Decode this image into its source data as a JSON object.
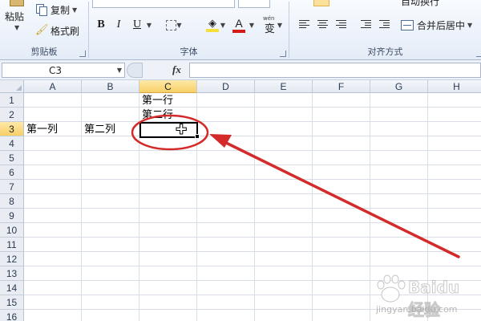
{
  "ribbon": {
    "clipboard": {
      "paste_label": "粘贴",
      "copy_label": "复制",
      "format_painter_label": "格式刷",
      "group_label": "剪贴板"
    },
    "font": {
      "bold_label": "B",
      "italic_label": "I",
      "underline_label": "U",
      "fill_color": "#f5e03b",
      "font_color": "#d61a1a",
      "font_color_glyph": "A",
      "phonetic_glyph": "wén",
      "phonetic_char": "变",
      "group_label": "字体"
    },
    "alignment": {
      "merge_label": "合并后居中",
      "wrap_label": "自动换行",
      "group_label": "对齐方式"
    }
  },
  "formula_bar": {
    "name_box": "C3",
    "fx": "fx",
    "value": ""
  },
  "grid": {
    "columns": [
      "A",
      "B",
      "C",
      "D",
      "E",
      "F",
      "G",
      "H"
    ],
    "rows": [
      "1",
      "2",
      "3",
      "4",
      "5",
      "6",
      "7",
      "8",
      "9",
      "10",
      "11",
      "12",
      "13",
      "14",
      "15",
      "16"
    ],
    "active_column": "C",
    "active_row": "3",
    "cells": {
      "C1": "第一行",
      "C2": "第二行",
      "A3": "第一列",
      "B3": "第二列"
    }
  },
  "annotation": {
    "color": "#d42a2a"
  },
  "watermark": {
    "text": "Baidu经验",
    "url": "jingyan.baidu.com"
  }
}
